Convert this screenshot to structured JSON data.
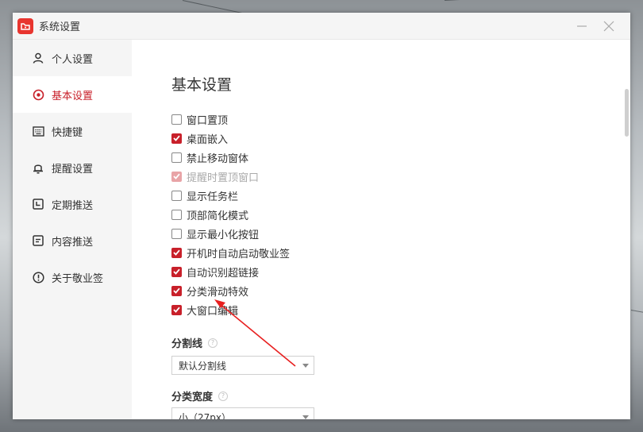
{
  "window": {
    "title": "系统设置",
    "minimize_icon": "minimize-icon",
    "close_icon": "close-icon"
  },
  "sidebar": {
    "items": [
      {
        "label": "个人设置",
        "icon": "user-icon",
        "active": false
      },
      {
        "label": "基本设置",
        "icon": "settings-icon",
        "active": true
      },
      {
        "label": "快捷键",
        "icon": "keyboard-icon",
        "active": false
      },
      {
        "label": "提醒设置",
        "icon": "bell-icon",
        "active": false
      },
      {
        "label": "定期推送",
        "icon": "schedule-icon",
        "active": false
      },
      {
        "label": "内容推送",
        "icon": "document-icon",
        "active": false
      },
      {
        "label": "关于敬业签",
        "icon": "info-icon",
        "active": false
      }
    ]
  },
  "main": {
    "title": "基本设置",
    "options": [
      {
        "label": "窗口置顶",
        "checked": false,
        "disabled": false
      },
      {
        "label": "桌面嵌入",
        "checked": true,
        "disabled": false
      },
      {
        "label": "禁止移动窗体",
        "checked": false,
        "disabled": false
      },
      {
        "label": "提醒时置顶窗口",
        "checked": true,
        "disabled": true
      },
      {
        "label": "显示任务栏",
        "checked": false,
        "disabled": false
      },
      {
        "label": "顶部简化模式",
        "checked": false,
        "disabled": false
      },
      {
        "label": "显示最小化按钮",
        "checked": false,
        "disabled": false
      },
      {
        "label": "开机时自动启动敬业签",
        "checked": true,
        "disabled": false
      },
      {
        "label": "自动识别超链接",
        "checked": true,
        "disabled": false
      },
      {
        "label": "分类滑动特效",
        "checked": true,
        "disabled": false
      },
      {
        "label": "大窗口编辑",
        "checked": true,
        "disabled": false
      }
    ],
    "divider_section": {
      "label": "分割线",
      "help": "?",
      "selected": "默认分割线"
    },
    "width_section": {
      "label": "分类宽度",
      "help": "?",
      "selected": "小（27px）"
    }
  },
  "colors": {
    "accent": "#c8202a",
    "annotation_arrow": "#e82020"
  }
}
